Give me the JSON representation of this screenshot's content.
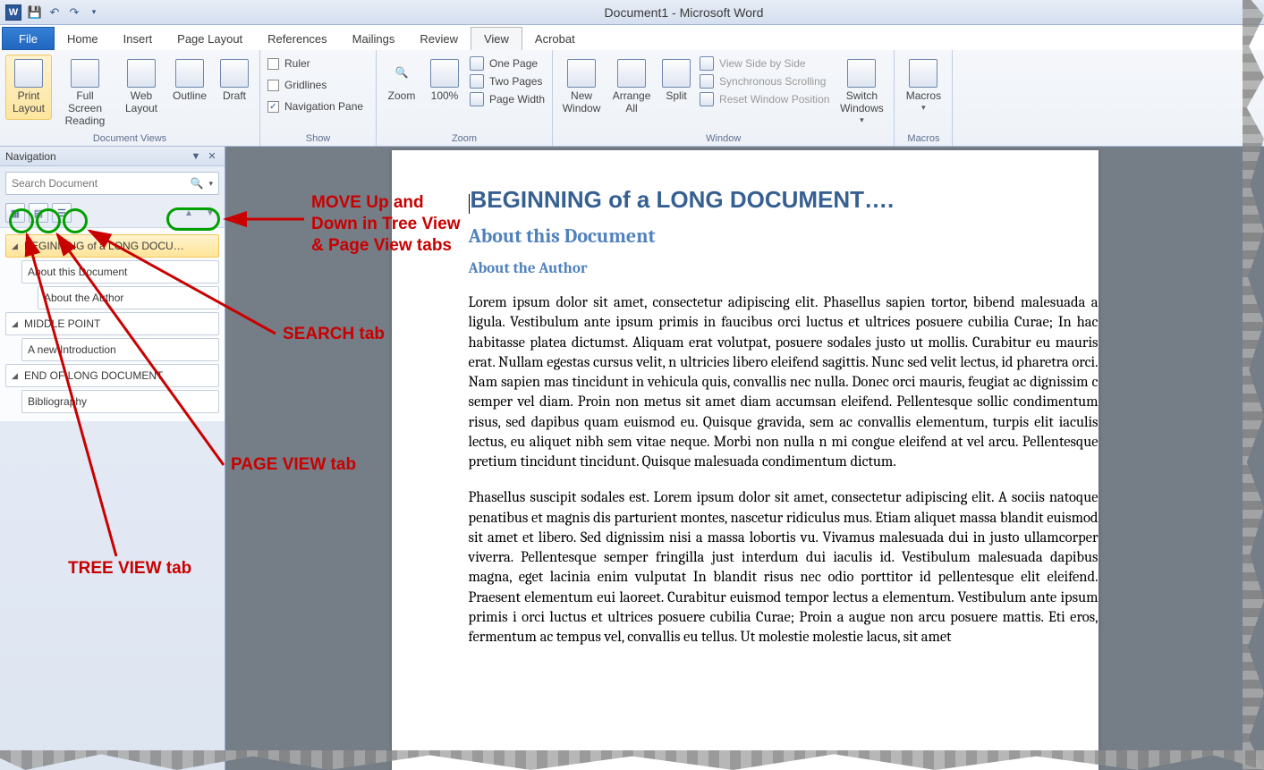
{
  "title": "Document1 - Microsoft Word",
  "qat": {
    "word_glyph": "W"
  },
  "tabs": {
    "file": "File",
    "items": [
      "Home",
      "Insert",
      "Page Layout",
      "References",
      "Mailings",
      "Review",
      "View",
      "Acrobat"
    ],
    "active": "View"
  },
  "ribbon": {
    "document_views": {
      "label": "Document Views",
      "print_layout": "Print Layout",
      "full_screen": "Full Screen Reading",
      "web_layout": "Web Layout",
      "outline": "Outline",
      "draft": "Draft"
    },
    "show": {
      "label": "Show",
      "ruler": "Ruler",
      "gridlines": "Gridlines",
      "nav_pane": "Navigation Pane",
      "nav_checked": "✓"
    },
    "zoom": {
      "label": "Zoom",
      "zoom": "Zoom",
      "hundred": "100%",
      "one_page": "One Page",
      "two_pages": "Two Pages",
      "page_width": "Page Width"
    },
    "window": {
      "label": "Window",
      "new": "New Window",
      "arrange": "Arrange All",
      "split": "Split",
      "side": "View Side by Side",
      "sync": "Synchronous Scrolling",
      "reset": "Reset Window Position",
      "switch": "Switch Windows"
    },
    "macros": {
      "label": "Macros",
      "macros": "Macros"
    }
  },
  "nav": {
    "title": "Navigation",
    "search_placeholder": "Search Document",
    "tree": [
      {
        "lvl": 0,
        "sel": true,
        "txt": "BEGINNING of a LONG DOCU…"
      },
      {
        "lvl": 1,
        "sel": false,
        "txt": "About this Document"
      },
      {
        "lvl": 2,
        "sel": false,
        "txt": "About the Author"
      },
      {
        "lvl": 0,
        "sel": false,
        "txt": "MIDDLE POINT"
      },
      {
        "lvl": 1,
        "sel": false,
        "txt": "A new Introduction"
      },
      {
        "lvl": 0,
        "sel": false,
        "txt": "END OF LONG DOCUMENT"
      },
      {
        "lvl": 1,
        "sel": false,
        "txt": "Bibliography"
      }
    ]
  },
  "doc": {
    "h1": "BEGINNING of a LONG DOCUMENT….",
    "h2": "About this Document",
    "h3": "About the Author",
    "p1": "Lorem ipsum dolor sit amet, consectetur adipiscing elit. Phasellus sapien tortor, bibend malesuada a ligula. Vestibulum ante ipsum primis in faucibus orci luctus et ultrices posuere cubilia Curae; In hac habitasse platea dictumst. Aliquam erat volutpat, posuere sodales justo ut mollis. Curabitur eu mauris erat. Nullam egestas cursus velit, n ultricies libero eleifend sagittis. Nunc sed velit lectus, id pharetra orci. Nam sapien mas tincidunt in vehicula quis, convallis nec nulla. Donec orci mauris, feugiat ac dignissim c semper vel diam. Proin non metus sit amet diam accumsan eleifend. Pellentesque sollic condimentum risus, sed dapibus quam euismod eu. Quisque gravida, sem ac convallis elementum, turpis elit iaculis lectus, eu aliquet nibh sem vitae neque. Morbi non nulla n mi congue eleifend at vel arcu. Pellentesque pretium tincidunt tincidunt. Quisque malesuada condimentum dictum.",
    "p2": "Phasellus suscipit sodales est. Lorem ipsum dolor sit amet, consectetur adipiscing elit. A sociis natoque penatibus et magnis dis parturient montes, nascetur ridiculus mus. Etiam aliquet massa blandit euismod sit amet et libero. Sed dignissim nisi a massa lobortis vu. Vivamus malesuada dui in justo ullamcorper viverra. Pellentesque semper fringilla just interdum dui iaculis id. Vestibulum malesuada dapibus magna, eget lacinia enim vulputat In blandit risus nec odio porttitor id pellentesque elit eleifend. Praesent elementum eui laoreet. Curabitur euismod tempor lectus a elementum. Vestibulum ante ipsum primis i orci luctus et ultrices posuere cubilia Curae; Proin a augue non arcu posuere mattis. Eti eros, fermentum ac tempus vel, convallis eu tellus. Ut molestie molestie lacus, sit amet"
  },
  "annotations": {
    "move": "MOVE Up and\nDown in Tree View\n& Page View tabs",
    "search": "SEARCH tab",
    "page": "PAGE VIEW tab",
    "tree": "TREE VIEW tab"
  }
}
